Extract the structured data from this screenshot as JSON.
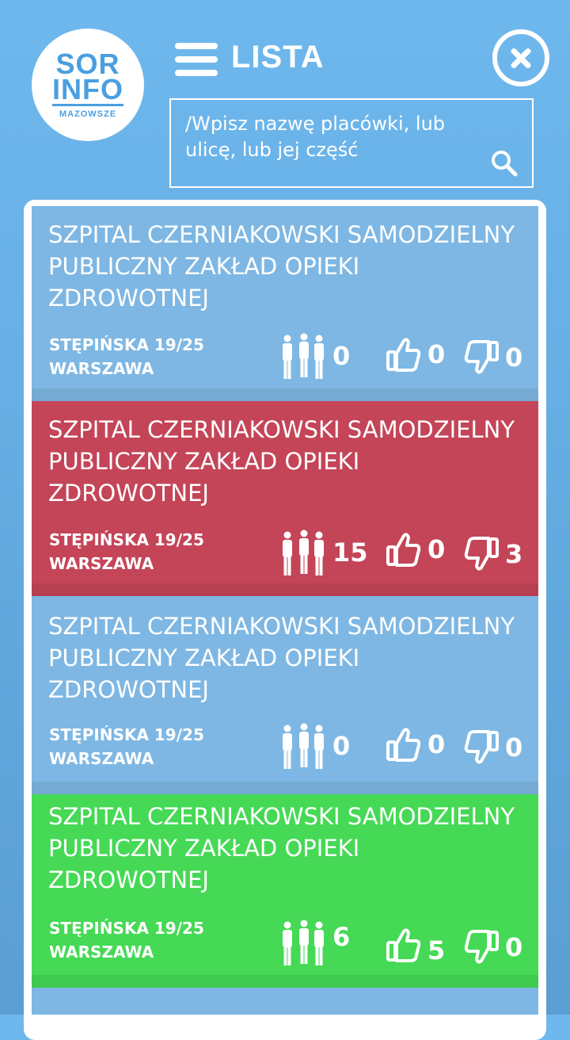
{
  "logo": {
    "line1": "SOR",
    "line2": "INFO",
    "line3": "MAZOWSZE"
  },
  "header": {
    "title": "LISTA"
  },
  "search": {
    "placeholder": "/Wpisz nazwę placówki, lub ulicę, lub jej część"
  },
  "colors": {
    "light": "#7eb7e3",
    "red": "#c44558",
    "green": "#45d955"
  },
  "cards": [
    {
      "name": "SZPITAL CZERNIAKOWSKI SAMODZIELNY PUBLICZNY ZAKŁAD OPIEKI ZDROWOTNEJ",
      "street": "STĘPIŃSKA 19/25",
      "city": "WARSZAWA",
      "people": "0",
      "likes": "0",
      "dislikes": "0",
      "status": "light"
    },
    {
      "name": "SZPITAL CZERNIAKOWSKI SAMODZIELNY PUBLICZNY ZAKŁAD OPIEKI ZDROWOTNEJ",
      "street": "STĘPIŃSKA 19/25",
      "city": "WARSZAWA",
      "people": "15",
      "likes": "0",
      "dislikes": "3",
      "status": "red"
    },
    {
      "name": "SZPITAL CZERNIAKOWSKI SAMODZIELNY PUBLICZNY ZAKŁAD OPIEKI ZDROWOTNEJ",
      "street": "STĘPIŃSKA 19/25",
      "city": "WARSZAWA",
      "people": "0",
      "likes": "0",
      "dislikes": "0",
      "status": "light"
    },
    {
      "name": "SZPITAL CZERNIAKOWSKI SAMODZIELNY PUBLICZNY ZAKŁAD OPIEKI ZDROWOTNEJ",
      "street": "STĘPIŃSKA 19/25",
      "city": "WARSZAWA",
      "people": "6",
      "likes": "5",
      "dislikes": "0",
      "status": "green"
    }
  ]
}
